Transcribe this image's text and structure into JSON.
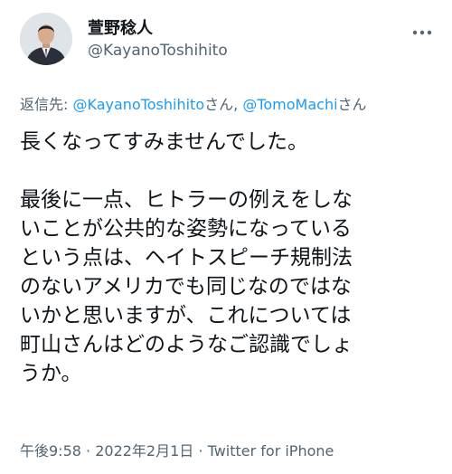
{
  "author": {
    "display_name": "萱野稔人",
    "handle": "@KayanoToshihito"
  },
  "reply": {
    "prefix": "返信先: ",
    "mention1": "@KayanoToshihito",
    "suffix1": "さん, ",
    "mention2": "@TomoMachi",
    "suffix2": "さん"
  },
  "tweet": {
    "line1": "長くなってすみませんでした。",
    "line2": "最後に一点、ヒトラーの例えをしな",
    "line3": "いことが公共的な姿勢になっている",
    "line4": "という点は、ヘイトスピーチ規制法",
    "line5": "のないアメリカでも同じなのではな",
    "line6": "いかと思いますが、これについては",
    "line7": "町山さんはどのようなご認識でしょ",
    "line8": "うか。"
  },
  "meta": {
    "time": "午後9:58",
    "separator1": " · ",
    "date": "2022年2月1日",
    "separator2": " · ",
    "source": "Twitter for iPhone"
  },
  "colors": {
    "text": "#0f1419",
    "secondary": "#536471",
    "link": "#1d9bf0"
  },
  "icons": {
    "more": "more-dots-icon",
    "avatar": "profile-photo"
  }
}
